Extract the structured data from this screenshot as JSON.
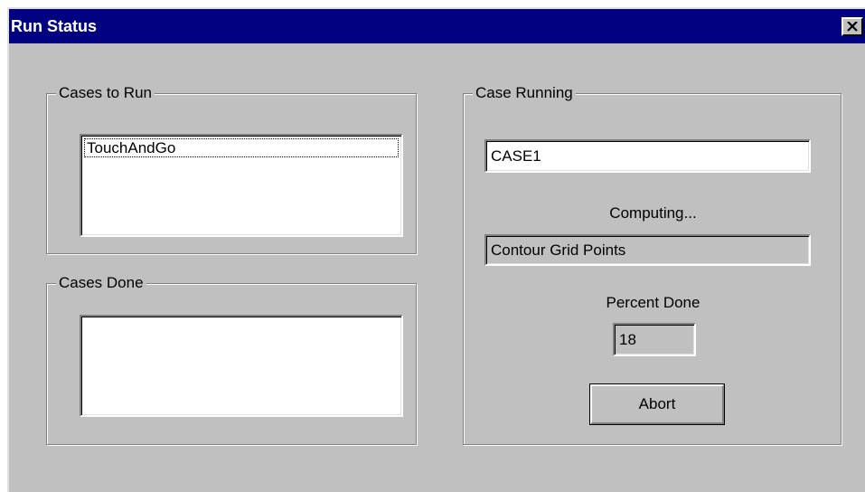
{
  "window": {
    "title": "Run Status",
    "close_icon": "close-icon"
  },
  "cases_to_run": {
    "label": "Cases to Run",
    "items": [
      "TouchAndGo"
    ]
  },
  "cases_done": {
    "label": "Cases Done",
    "items": []
  },
  "case_running": {
    "label": "Case Running",
    "case_name": "CASE1",
    "computing_label": "Computing...",
    "computing_value": "Contour Grid Points",
    "percent_label": "Percent Done",
    "percent_value": "18",
    "abort_label": "Abort"
  },
  "colors": {
    "titlebar": "#000080",
    "face": "#c0c0c0"
  }
}
